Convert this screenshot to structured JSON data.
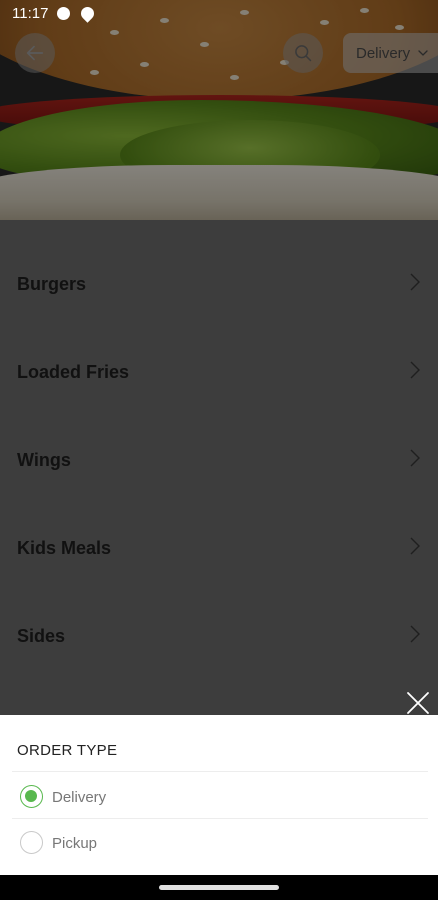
{
  "status_bar": {
    "time": "11:17"
  },
  "header": {
    "order_type_selected": "Delivery"
  },
  "menu": {
    "categories": [
      {
        "label": "Burgers"
      },
      {
        "label": "Loaded Fries"
      },
      {
        "label": "Wings"
      },
      {
        "label": "Kids Meals"
      },
      {
        "label": "Sides"
      }
    ]
  },
  "order_sheet": {
    "title": "ORDER TYPE",
    "options": [
      {
        "label": "Delivery",
        "selected": true
      },
      {
        "label": "Pickup",
        "selected": false
      }
    ]
  },
  "colors": {
    "accent": "#58b84e",
    "overlay": "#3d3d3d",
    "sheet_background": "#ffffff"
  }
}
